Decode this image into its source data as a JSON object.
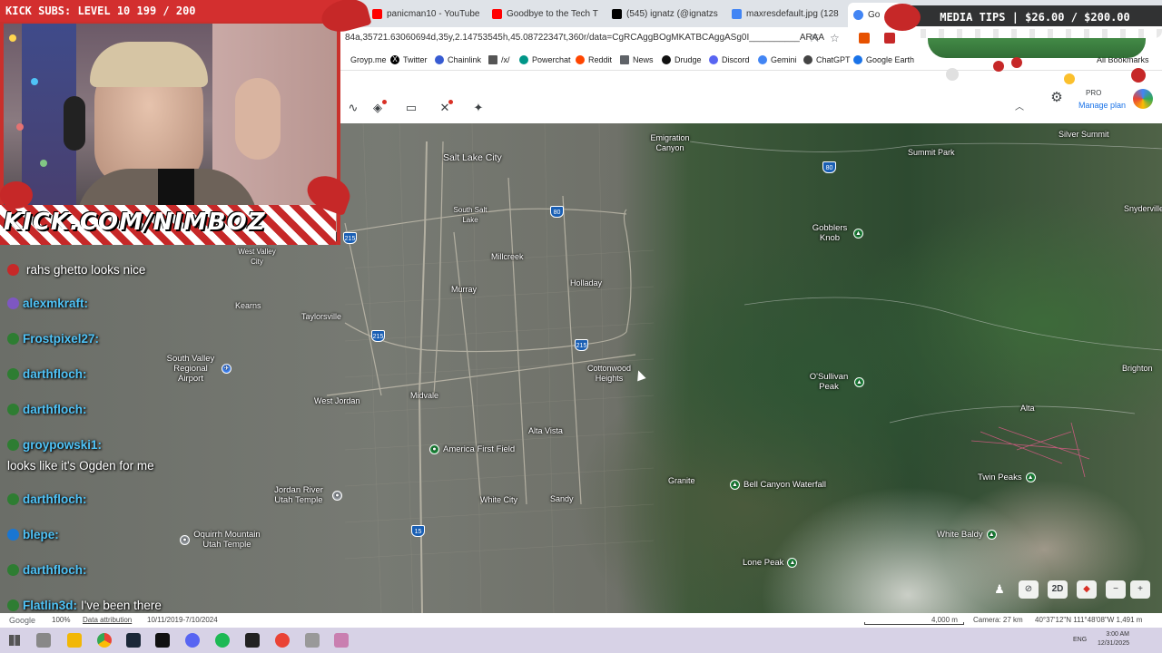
{
  "browser": {
    "tabs": [
      {
        "label": "panicman10 - YouTube",
        "color": "#ff0000"
      },
      {
        "label": "Goodbye to the Tech T",
        "color": "#ff0000"
      },
      {
        "label": "(545) ignatz (@ignatzs",
        "color": "#000000"
      },
      {
        "label": "maxresdefault.jpg (128",
        "color": "#4285f4"
      },
      {
        "label": "Go",
        "color": "#4285f4"
      }
    ],
    "url": "84a,35721.63060694d,35y,2.14753545h,45.08722347t,360r/data=CgRCAggBOgMKATBCAggASg0I__________ARAA",
    "bookmarks": [
      {
        "label": "Groyp.me",
        "icon": "globe-icon"
      },
      {
        "label": "Twitter",
        "icon": "x-icon"
      },
      {
        "label": "Chainlink",
        "icon": "chainlink-icon"
      },
      {
        "label": "/x/",
        "icon": "grid-icon"
      },
      {
        "label": "Powerchat",
        "icon": "arrow-icon"
      },
      {
        "label": "Reddit",
        "icon": "reddit-icon"
      },
      {
        "label": "News",
        "icon": "folder-icon"
      },
      {
        "label": "Drudge",
        "icon": "drudge-icon"
      },
      {
        "label": "Discord",
        "icon": "discord-icon"
      },
      {
        "label": "Gemini",
        "icon": "gemini-icon"
      },
      {
        "label": "ChatGPT",
        "icon": "chatgpt-icon"
      },
      {
        "label": "Google Earth",
        "icon": "earth-icon"
      }
    ],
    "all_bookmarks": "All Bookmarks"
  },
  "earth": {
    "pro_label": "PRO",
    "manage_plan": "Manage plan",
    "map_labels": [
      {
        "name": "Salt Lake City"
      },
      {
        "name": "South Salt Lake"
      },
      {
        "name": "Millcreek"
      },
      {
        "name": "Holladay"
      },
      {
        "name": "Murray"
      },
      {
        "name": "Emigration Canyon"
      },
      {
        "name": "Summit Park"
      },
      {
        "name": "Silver Summit"
      },
      {
        "name": "Snyderville"
      },
      {
        "name": "West Valley City"
      },
      {
        "name": "Kearns"
      },
      {
        "name": "Taylorsville"
      },
      {
        "name": "Cottonwood Heights"
      },
      {
        "name": "West Jordan"
      },
      {
        "name": "Midvale"
      },
      {
        "name": "Alta Vista"
      },
      {
        "name": "White City"
      },
      {
        "name": "Sandy"
      },
      {
        "name": "Granite"
      },
      {
        "name": "Alta"
      },
      {
        "name": "Brighton"
      }
    ],
    "pois": [
      {
        "name": "Gobblers Knob"
      },
      {
        "name": "O'Sullivan Peak"
      },
      {
        "name": "Bell Canyon Waterfall"
      },
      {
        "name": "Twin Peaks"
      },
      {
        "name": "White Baldy"
      },
      {
        "name": "Lone Peak"
      },
      {
        "name": "America First Field"
      },
      {
        "name": "South Valley Regional Airport"
      },
      {
        "name": "Jordan River Utah Temple"
      },
      {
        "name": "Oquirrh Mountain Utah Temple"
      }
    ],
    "shields": [
      "80",
      "80",
      "215",
      "215",
      "215",
      "15"
    ],
    "controls": {
      "view_2d": "2D"
    },
    "status": {
      "brand": "Google",
      "zoom": "100%",
      "attribution": "Data attribution",
      "dates": "10/11/2019-7/10/2024",
      "scale": "4,000 m",
      "camera": "Camera: 27 km",
      "coords": "40°37'12\"N 111°48'08\"W 1,491 m"
    }
  },
  "overlay": {
    "kick_subs": "KICK SUBS: LEVEL 10 199 / 200",
    "media_tips": "MEDIA TIPS | $26.00 / $200.00",
    "kick_url": "KICK.COM/NIMBOZ",
    "chat": [
      {
        "name": "",
        "text": "rahs ghetto looks nice",
        "badge": "#d32f2f"
      },
      {
        "name": "alexmkraft:",
        "text": "",
        "badge": "#7e57c2"
      },
      {
        "name": "Frostpixel27:",
        "text": "",
        "badge": "#2e7d32"
      },
      {
        "name": "darthfloch:",
        "text": "",
        "badge": "#2e7d32"
      },
      {
        "name": "darthfloch:",
        "text": "",
        "badge": "#2e7d32"
      },
      {
        "name": "groypowski1:",
        "text": "",
        "badge": "#2e7d32"
      },
      {
        "name": "",
        "text": "looks like it's Ogden for me",
        "badge": ""
      },
      {
        "name": "darthfloch:",
        "text": "",
        "badge": "#2e7d32"
      },
      {
        "name": "blepe:",
        "text": "",
        "badge": "#1976d2"
      },
      {
        "name": "darthfloch:",
        "text": "",
        "badge": "#2e7d32"
      },
      {
        "name": "Flatlin3d:",
        "text": "I've been there",
        "badge": "#2e7d32"
      }
    ]
  },
  "taskbar": {
    "clock_time": "3:00 AM",
    "clock_date": "12/31/2025",
    "lang": "ENG"
  }
}
